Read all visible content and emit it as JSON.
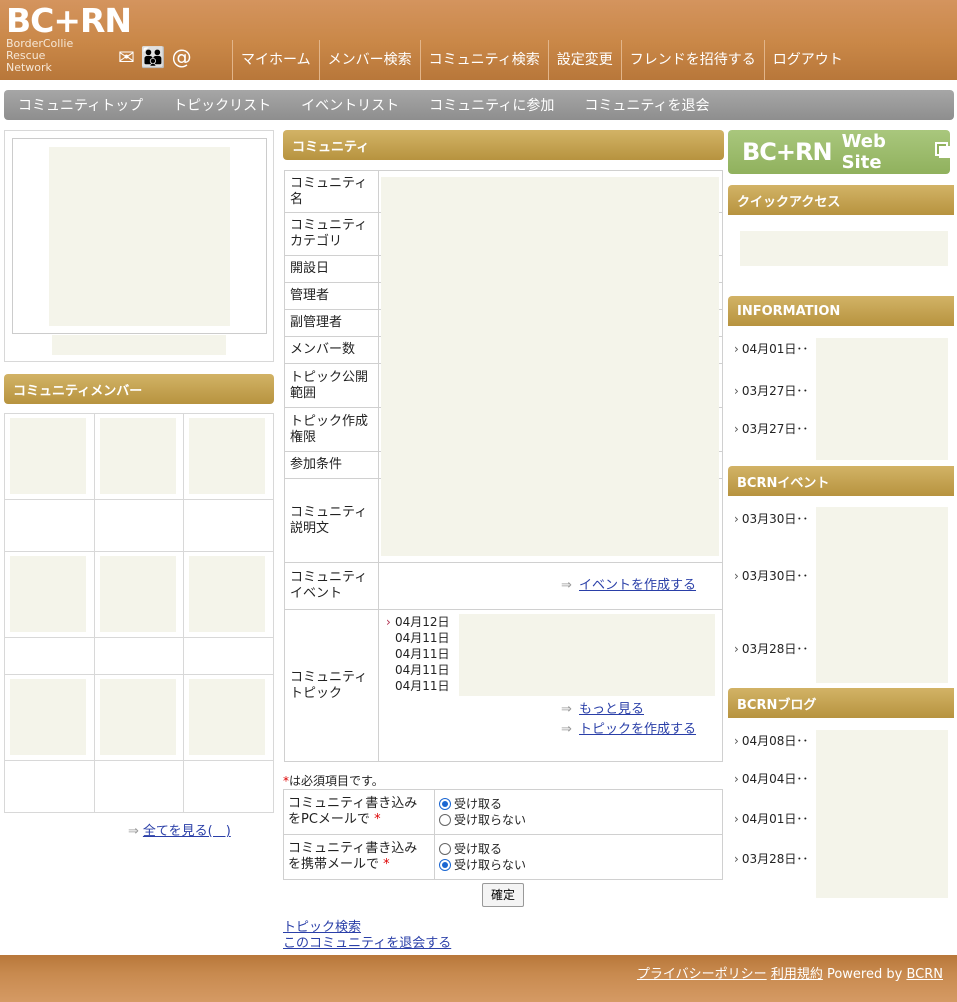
{
  "header": {
    "logo_text": "BC+RN",
    "logo_sub": [
      "BorderCollie",
      "Rescue",
      "Network"
    ],
    "nav": [
      "マイホーム",
      "メンバー検索",
      "コミュニティ検索",
      "設定変更",
      "フレンドを招待する",
      "ログアウト"
    ]
  },
  "subnav": [
    "コミュニティトップ",
    "トピックリスト",
    "イベントリスト",
    "コミュニティに参加",
    "コミュニティを退会"
  ],
  "left": {
    "members_title": "コミュニティメンバー",
    "see_all": "全てを見る(　)"
  },
  "community": {
    "title": "コミュニティ",
    "fields": [
      "コミュニティ名",
      "コミュニティカテゴリ",
      "開設日",
      "管理者",
      "副管理者",
      "メンバー数",
      "トピック公開範囲",
      "トピック作成権限",
      "参加条件",
      "コミュニティ説明文"
    ],
    "event_label": "コミュニティイベント",
    "create_event": "イベントを作成する",
    "topic_label": "コミュニティトピック",
    "topic_dates": [
      "04月12日",
      "04月11日",
      "04月11日",
      "04月11日",
      "04月11日"
    ],
    "more": "もっと見る",
    "create_topic": "トピックを作成する"
  },
  "mail_settings": {
    "required_note": "は必須項目です。",
    "required_mark": "*",
    "rows": [
      {
        "label": "コミュニティ書き込みをPCメールで",
        "selected": 0
      },
      {
        "label": "コミュニティ書き込みを携帯メールで",
        "selected": 1
      }
    ],
    "opt_receive": "受け取る",
    "opt_decline": "受け取らない",
    "confirm": "確定",
    "accent": "#1a66d2"
  },
  "bottom_links": [
    "トピック検索",
    "このコミュニティを退会する"
  ],
  "right": {
    "banner_brand": "BC+RN",
    "banner_text": "Web Site",
    "quick_access": "クイックアクセス",
    "information_title": "INFORMATION",
    "information": [
      "04月01日･･",
      "03月27日･･",
      "03月27日･･"
    ],
    "events_title": "BCRNイベント",
    "events": [
      "03月30日･･",
      "03月30日･･",
      "03月28日･･"
    ],
    "blog_title": "BCRNブログ",
    "blog": [
      "04月08日･･",
      "04月04日･･",
      "04月01日･･",
      "03月28日･･"
    ]
  },
  "footer": {
    "privacy": "プライバシーポリシー",
    "terms": "利用規約",
    "powered": "Powered by",
    "brand": "BCRN"
  },
  "colors": {
    "header": "#c98747",
    "section_gold": "#b7933f",
    "subnav_gray": "#9a9a9a",
    "banner_green": "#9dbc6d",
    "placeholder": "#f4f4ea"
  }
}
